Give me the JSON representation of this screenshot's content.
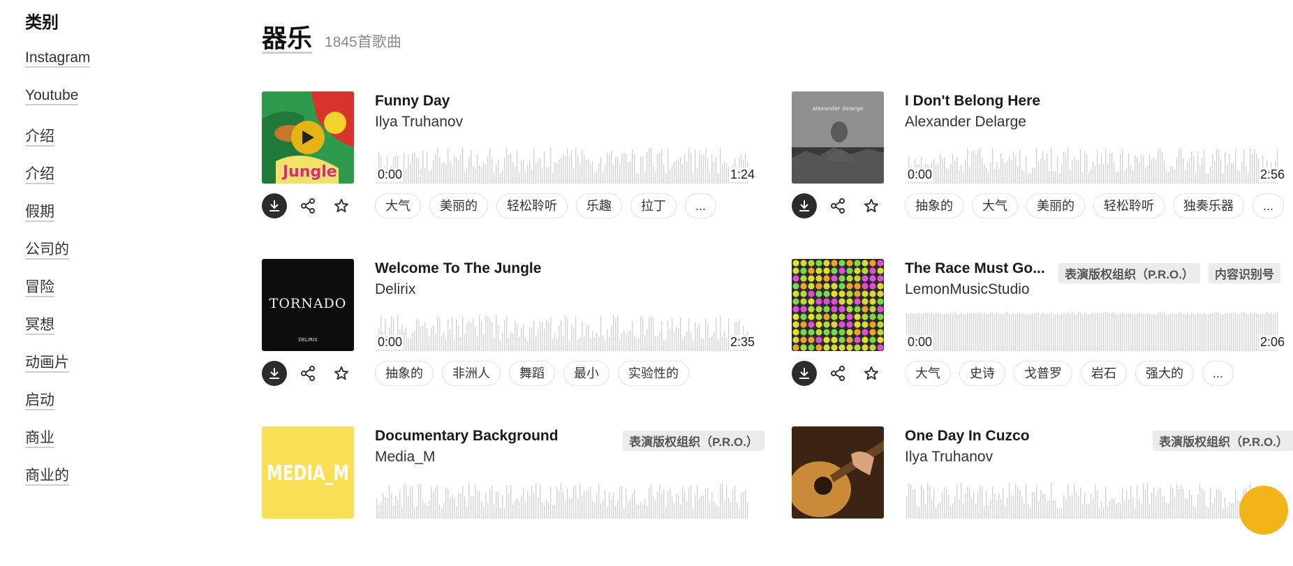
{
  "sidebar": {
    "title": "类别",
    "items": [
      "Instagram",
      "Youtube",
      "介绍",
      "介绍",
      "假期",
      "公司的",
      "冒险",
      "冥想",
      "动画片",
      "启动",
      "商业",
      "商业的"
    ]
  },
  "header": {
    "title": "器乐",
    "count": "1845首歌曲"
  },
  "colors": {
    "accent": "#e4b315",
    "wave": "#d3d3d3",
    "download_button": "#2b2b2b"
  },
  "tracks": [
    {
      "title": "Funny Day",
      "artist": "Ilya Truhanov",
      "start_time": "0:00",
      "duration": "1:24",
      "tags": [
        "大气",
        "美丽的",
        "轻松聆听",
        "乐趣",
        "拉丁",
        "..."
      ],
      "badges": [],
      "cover_icon": "colorful-cartoon-cover",
      "playing": true
    },
    {
      "title": "I Don't Belong Here",
      "artist": "Alexander Delarge",
      "start_time": "0:00",
      "duration": "2:56",
      "tags": [
        "抽象的",
        "大气",
        "美丽的",
        "轻松聆听",
        "独奏乐器",
        "..."
      ],
      "badges": [],
      "cover_icon": "grayscale-silhouette-cover",
      "cover_text": "alexander delarge"
    },
    {
      "title": "Welcome To The Jungle",
      "artist": "Delirix",
      "start_time": "0:00",
      "duration": "2:35",
      "tags": [
        "抽象的",
        "非洲人",
        "舞蹈",
        "最小",
        "实验性的"
      ],
      "badges": [],
      "cover_icon": "tornado-cover",
      "cover_text": "TORNADO",
      "cover_subtext": "DELIRIX"
    },
    {
      "title": "The Race Must Go...",
      "artist": "LemonMusicStudio",
      "start_time": "0:00",
      "duration": "2:06",
      "tags": [
        "大气",
        "史诗",
        "戈普罗",
        "岩石",
        "强大的",
        "..."
      ],
      "badges": [
        "表演版权组织（P.R.O.）",
        "内容识别号"
      ],
      "cover_icon": "led-dots-cover"
    },
    {
      "title": "Documentary Background",
      "artist": "Media_M",
      "tags": [],
      "badges": [
        "表演版权组织（P.R.O.）"
      ],
      "cover_icon": "yellow-text-cover",
      "cover_text": "MEDIA_M"
    },
    {
      "title": "One Day In Cuzco",
      "artist": "Ilya Truhanov",
      "tags": [],
      "badges": [
        "表演版权组织（P.R.O.）"
      ],
      "cover_icon": "guitar-cover"
    }
  ]
}
